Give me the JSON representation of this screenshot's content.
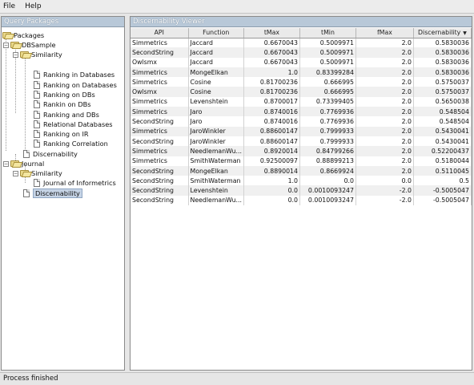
{
  "menu": {
    "file": "File",
    "help": "Help"
  },
  "left_panel": {
    "title": "Query Packages"
  },
  "tree": {
    "packages": "Packages",
    "dbsample": "DBSample",
    "similarity1": "Similarity",
    "items1": [
      "Ranking in Databases",
      "Ranking on Databases",
      "Ranking on DBs",
      "Rankin on DBs",
      "Ranking and DBs",
      "Relational Databases",
      "Ranking on IR",
      "Ranking Correlation"
    ],
    "discernability1": "Discernability",
    "journal": "Journal",
    "similarity2": "Similarity",
    "journal_item": "Journal of Informetrics",
    "discernability2": "Discernability"
  },
  "right_panel": {
    "title": "Discernability Viewer"
  },
  "table": {
    "columns": [
      "API",
      "Function",
      "tMax",
      "tMin",
      "fMax",
      "Discernability"
    ],
    "sort_column": "Discernability",
    "rows": [
      [
        "Simmetrics",
        "Jaccard",
        "0.6670043",
        "0.5009971",
        "2.0",
        "0.5830036"
      ],
      [
        "SecondString",
        "Jaccard",
        "0.6670043",
        "0.5009971",
        "2.0",
        "0.5830036"
      ],
      [
        "Owlsmx",
        "Jaccard",
        "0.6670043",
        "0.5009971",
        "2.0",
        "0.5830036"
      ],
      [
        "Simmetrics",
        "MongeElkan",
        "1.0",
        "0.83399284",
        "2.0",
        "0.5830036"
      ],
      [
        "Simmetrics",
        "Cosine",
        "0.81700236",
        "0.666995",
        "2.0",
        "0.5750037"
      ],
      [
        "Owlsmx",
        "Cosine",
        "0.81700236",
        "0.666995",
        "2.0",
        "0.5750037"
      ],
      [
        "Simmetrics",
        "Levenshtein",
        "0.8700017",
        "0.73399405",
        "2.0",
        "0.5650038"
      ],
      [
        "Simmetrics",
        "Jaro",
        "0.8740016",
        "0.7769936",
        "2.0",
        "0.548504"
      ],
      [
        "SecondString",
        "Jaro",
        "0.8740016",
        "0.7769936",
        "2.0",
        "0.548504"
      ],
      [
        "Simmetrics",
        "JaroWinkler",
        "0.88600147",
        "0.7999933",
        "2.0",
        "0.5430041"
      ],
      [
        "SecondString",
        "JaroWinkler",
        "0.88600147",
        "0.7999933",
        "2.0",
        "0.5430041"
      ],
      [
        "Simmetrics",
        "NeedlemanWu...",
        "0.8920014",
        "0.84799266",
        "2.0",
        "0.52200437"
      ],
      [
        "Simmetrics",
        "SmithWaterman",
        "0.92500097",
        "0.88899213",
        "2.0",
        "0.5180044"
      ],
      [
        "SecondString",
        "MongeElkan",
        "0.8890014",
        "0.8669924",
        "2.0",
        "0.5110045"
      ],
      [
        "SecondString",
        "SmithWaterman",
        "1.0",
        "0.0",
        "0.0",
        "0.5"
      ],
      [
        "SecondString",
        "Levenshtein",
        "0.0",
        "0.0010093247",
        "-2.0",
        "-0.5005047"
      ],
      [
        "SecondString",
        "NeedlemanWu...",
        "0.0",
        "0.0010093247",
        "-2.0",
        "-0.5005047"
      ]
    ]
  },
  "status": "Process finished"
}
